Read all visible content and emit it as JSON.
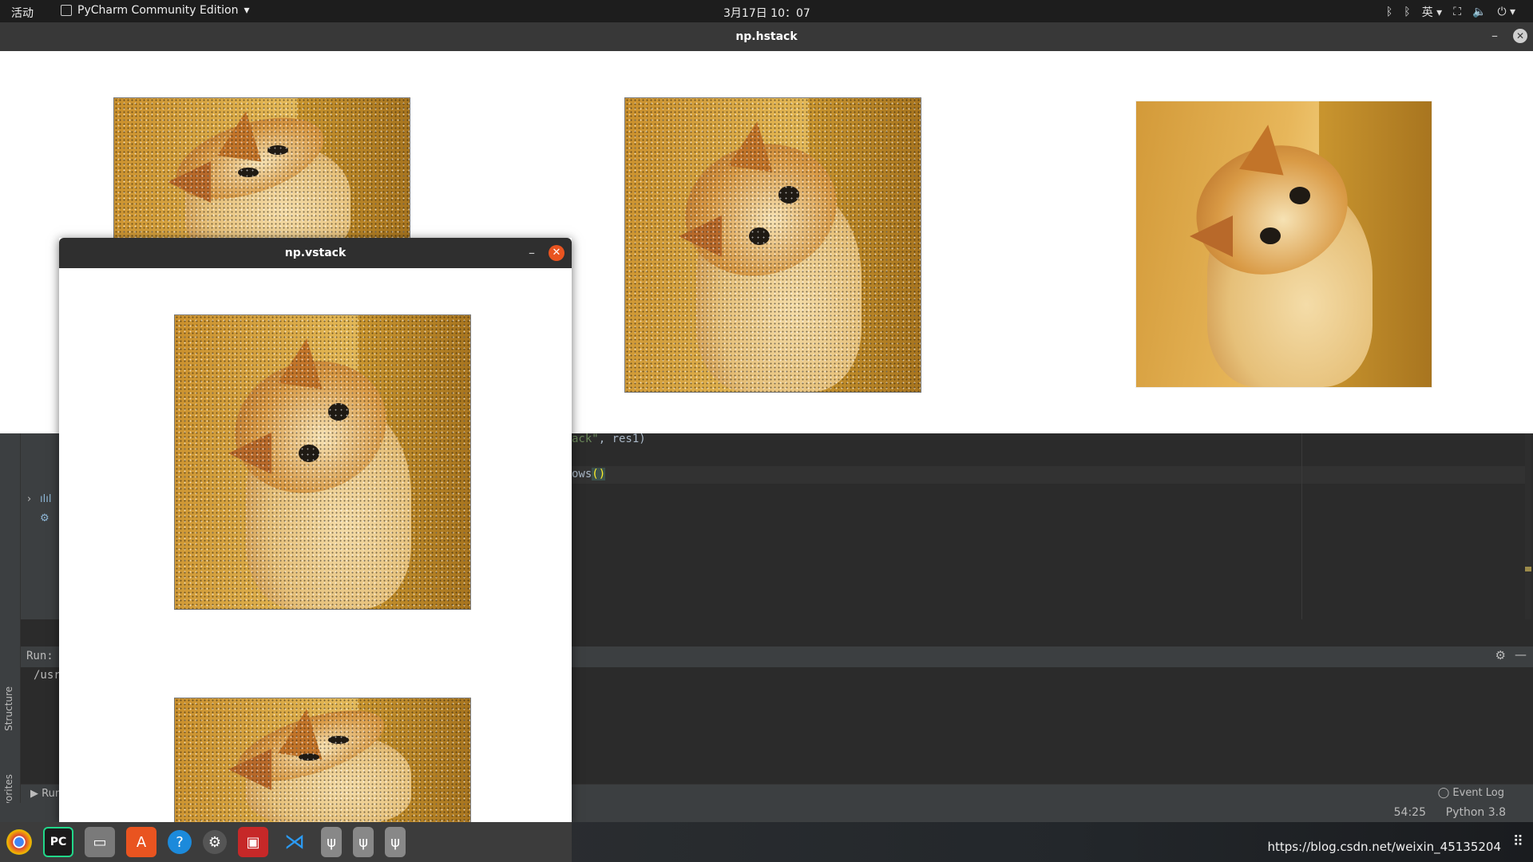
{
  "topbar": {
    "activities": "活动",
    "app_name": "PyCharm Community Edition",
    "clock": "3月17日  10：07",
    "input_method": "英"
  },
  "hstack_window": {
    "title": "np.hstack"
  },
  "vstack_window": {
    "title": "np.vstack"
  },
  "editor": {
    "line1": {
      "str": "ack\"",
      "rest": ", res1)"
    },
    "line2": {
      "prefix": "ows",
      "paren": "()"
    }
  },
  "run_panel": {
    "label": "Run:",
    "path": "/usr"
  },
  "side_tabs": {
    "structure": "Structure",
    "favorites": "Favorites"
  },
  "bottom_tools": {
    "run": "Run",
    "event_log": "Event Log"
  },
  "statusbar": {
    "position": "54:25",
    "interpreter": "Python 3.8"
  },
  "taskbar": {
    "watermark": "https://blog.csdn.net/weixin_45135204"
  },
  "colors": {
    "close_accent": "#e95420",
    "ide_background": "#2b2b2b",
    "panel_background": "#3c3f41"
  }
}
